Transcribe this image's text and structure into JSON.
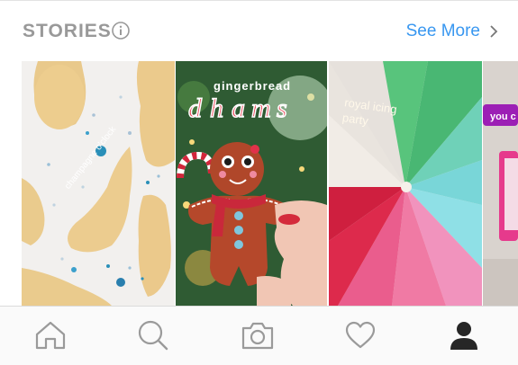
{
  "header": {
    "title": "STORIES",
    "see_more_label": "See More"
  },
  "stories": [
    {
      "overlay_text": "champagne o'clock"
    },
    {
      "overlay_text": "gingerbread"
    },
    {
      "overlay_text": "royal icing party"
    },
    {
      "overlay_text": "you c"
    }
  ],
  "tab_bar": {
    "icons": [
      "home-icon",
      "search-icon",
      "camera-icon",
      "heart-icon",
      "profile-icon"
    ],
    "active": "profile-icon"
  },
  "colors": {
    "accent": "#3897f0",
    "title_gray": "#999999",
    "icon_gray": "#9a9a9a",
    "active_icon": "#262626"
  }
}
